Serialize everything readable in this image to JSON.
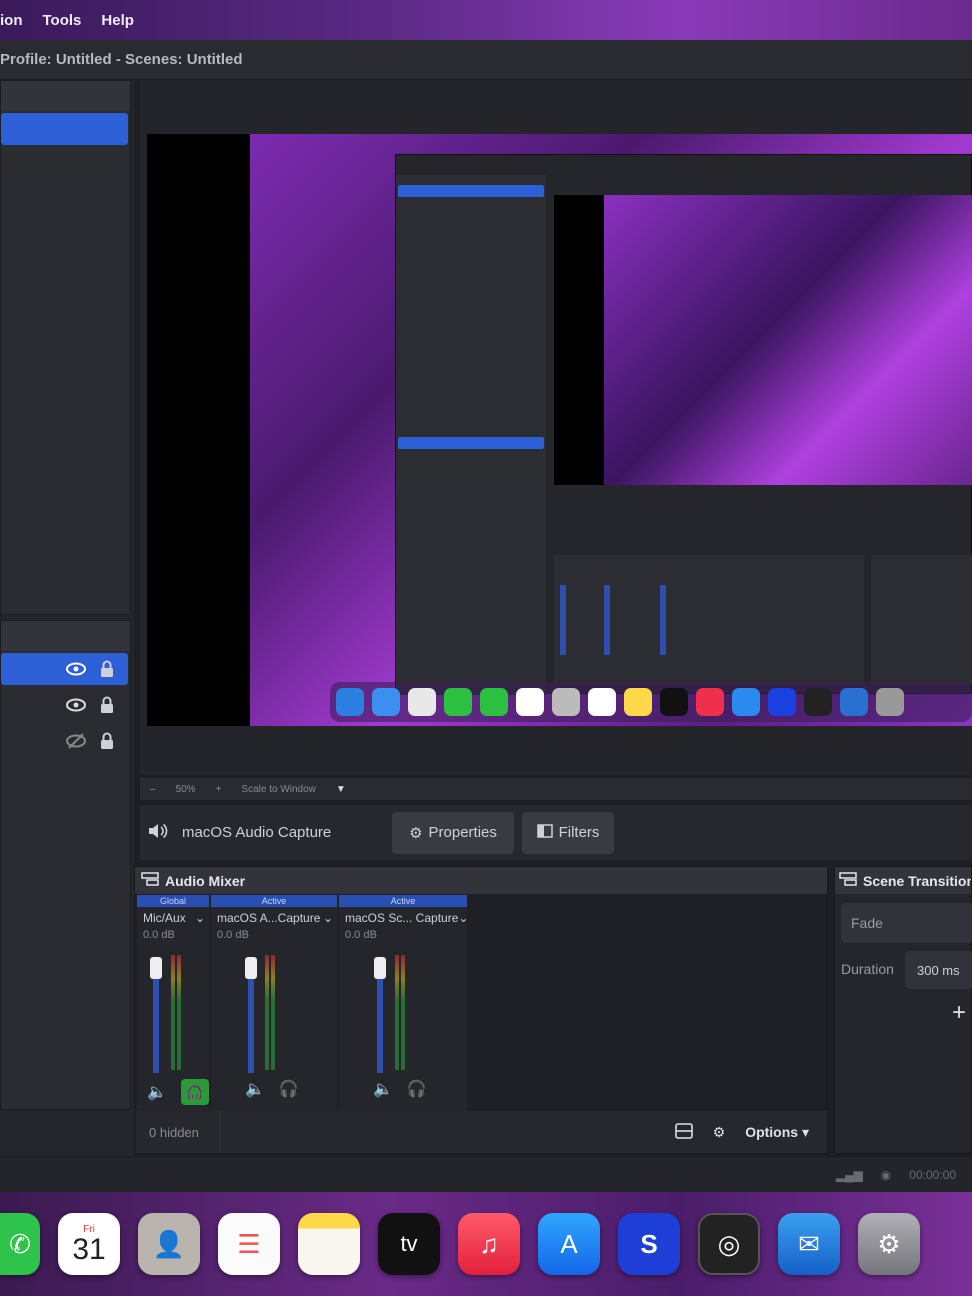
{
  "menu": {
    "items": [
      "ion",
      "Tools",
      "Help"
    ]
  },
  "window": {
    "title": "Profile: Untitled - Scenes: Untitled"
  },
  "zoom": {
    "minus": "–",
    "value": "50%",
    "plus": "+",
    "mode": "Scale to Window"
  },
  "context": {
    "source_name": "macOS Audio Capture",
    "properties_label": "Properties",
    "filters_label": "Filters"
  },
  "mixer": {
    "title": "Audio Mixer",
    "channels": [
      {
        "status": "Global",
        "name": "Mic/Aux",
        "db": "0.0 dB",
        "monitor": true
      },
      {
        "status": "Active",
        "name": "macOS A...Capture",
        "db": "0.0 dB",
        "monitor": false
      },
      {
        "status": "Active",
        "name": "macOS Sc... Capture",
        "db": "0.0 dB",
        "monitor": false
      }
    ],
    "hidden_label": "0 hidden",
    "options_label": "Options"
  },
  "transitions": {
    "title": "Scene Transition",
    "selected": "Fade",
    "duration_label": "Duration",
    "duration_value": "300 ms"
  },
  "status": {
    "time": "00:00:00"
  },
  "dock": {
    "calendar_day": "Fri",
    "calendar_date": "31",
    "apps": [
      "phone-icon",
      "calendar-icon",
      "contacts-icon",
      "reminders-icon",
      "notes-icon",
      "appletv-icon",
      "music-icon",
      "appstore-icon",
      "shazam-icon",
      "obs-icon",
      "outlook-icon",
      "settings-icon"
    ],
    "tv_label": "tv"
  },
  "colors": {
    "accent": "#2d5fd6",
    "monitor_active": "#2c9a3a"
  }
}
